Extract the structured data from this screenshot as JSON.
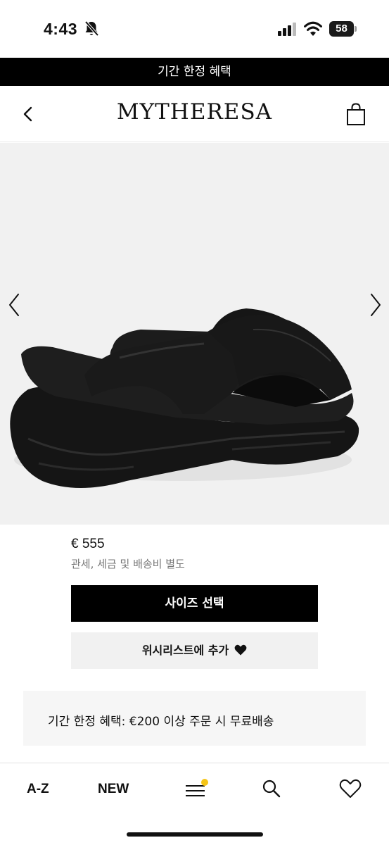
{
  "status_bar": {
    "time": "4:43",
    "battery": "58"
  },
  "promo_banner": {
    "text": "기간 한정 혜택"
  },
  "header": {
    "logo": "MYTHERESA"
  },
  "icons": {
    "back": "chevron-left-icon",
    "bag": "shopping-bag-icon",
    "gallery_prev": "chevron-left-icon",
    "gallery_next": "chevron-right-icon",
    "heart": "heart-icon",
    "menu": "menu-icon",
    "search": "search-icon",
    "wishlist": "heart-outline-icon"
  },
  "product": {
    "price": "€ 555",
    "tax_note": "관세, 세금 및 배송비 별도"
  },
  "actions": {
    "select_size": "사이즈 선택",
    "add_to_wishlist": "위시리스트에 추가"
  },
  "offer": {
    "text": "기간 한정 혜택: €200 이상 주문 시 무료배송"
  },
  "bottom_nav": {
    "az": "A-Z",
    "new": "NEW"
  },
  "colors": {
    "banner_bg": "#000000",
    "primary_button": "#000000",
    "secondary_button": "#f1f1f1",
    "menu_badge": "#f5c518"
  }
}
